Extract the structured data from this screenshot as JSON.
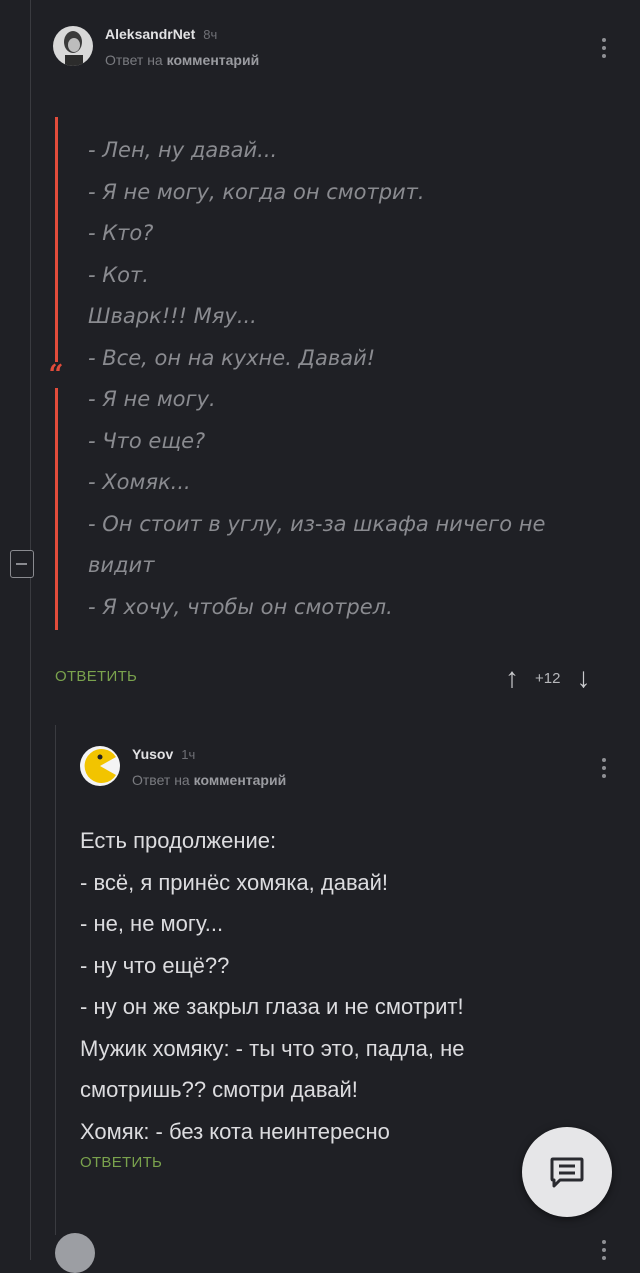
{
  "comment1": {
    "author": "AleksandrNet",
    "time": "8ч",
    "reply_prefix": "Ответ на",
    "reply_target": "комментарий",
    "quote_lines": [
      "- Лен, ну давай...",
      "- Я не могу, когда он смотрит.",
      "- Кто?",
      "- Кот.",
      "Шварк!!! Мяу...",
      "- Все, он на кухне. Давай!",
      "- Я не могу.",
      "- Что еще?",
      "- Хомяк...",
      "- Он стоит в углу, из-за шкафа ничего не",
      "видит",
      "- Я хочу, чтобы он смотрел."
    ],
    "reply_label": "ОТВЕТИТЬ",
    "rating": "+12",
    "accent_color": "#e24c3b"
  },
  "comment2": {
    "author": "Yusov",
    "time": "1ч",
    "reply_prefix": "Ответ на",
    "reply_target": "комментарий",
    "body_lines": [
      "Есть продолжение:",
      "- всё, я принёс хомяка, давай!",
      "- не, не могу...",
      "- ну что ещё??",
      "- ну он же закрыл глаза и не смотрит!",
      "Мужик хомяку:  - ты что это, падла, не",
      "смотришь?? смотри давай!",
      "Хомяк:  - без кота неинтересно"
    ],
    "reply_label": "ОТВЕТИТЬ"
  },
  "colors": {
    "background": "#1f2025",
    "reply_link": "#7aa24d"
  },
  "icons": [
    "user-avatar-icon",
    "pacman-avatar-icon",
    "more-vertical-icon",
    "collapse-icon",
    "quote-icon",
    "arrow-up-icon",
    "arrow-down-icon",
    "comment-icon"
  ]
}
